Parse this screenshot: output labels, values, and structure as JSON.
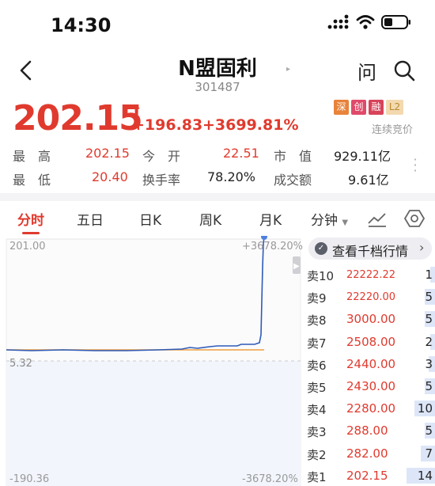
{
  "status_bar": {
    "time": "14:30"
  },
  "header": {
    "stock_name": "N盟固利",
    "stock_code": "301487",
    "ask_label": "问"
  },
  "quote": {
    "price": "202.15",
    "change_abs": "+196.83",
    "change_pct": "+3699.81%",
    "badges": [
      "深",
      "创",
      "融",
      "L2"
    ],
    "status_text": "连续竞价"
  },
  "stats": {
    "high_label": "最　高",
    "high_value": "202.15",
    "open_label": "今　开",
    "open_value": "22.51",
    "mktcap_label": "市　值",
    "mktcap_value": "929.11亿",
    "low_label": "最　低",
    "low_value": "20.40",
    "turnover_label": "换手率",
    "turnover_value": "78.20%",
    "volume_label": "成交额",
    "volume_value": "9.61亿"
  },
  "tabs": [
    "分时",
    "五日",
    "日K",
    "周K",
    "月K",
    "分钟"
  ],
  "chart": {
    "y_top_label": "201.00",
    "y_mid_label": "5.32",
    "y_bottom_label": "-190.36",
    "pct_top_label": "+3678.20%",
    "pct_bottom_label": "-3678.20%"
  },
  "order_book": {
    "header": "查看千档行情",
    "rows": [
      {
        "label": "卖10",
        "price": "22222.22",
        "volume": "1"
      },
      {
        "label": "卖9",
        "price": "22220.00",
        "volume": "5"
      },
      {
        "label": "卖8",
        "price": "3000.00",
        "volume": "5"
      },
      {
        "label": "卖7",
        "price": "2508.00",
        "volume": "2"
      },
      {
        "label": "卖6",
        "price": "2440.00",
        "volume": "3"
      },
      {
        "label": "卖5",
        "price": "2430.00",
        "volume": "5"
      },
      {
        "label": "卖4",
        "price": "2280.00",
        "volume": "10"
      },
      {
        "label": "卖3",
        "price": "288.00",
        "volume": "5"
      },
      {
        "label": "卖2",
        "price": "282.00",
        "volume": "7"
      },
      {
        "label": "卖1",
        "price": "202.15",
        "volume": "14"
      }
    ]
  },
  "colors": {
    "up": "#e03a2e",
    "price_line": "#2e5bb8",
    "avg_line": "#f0a040",
    "volume_bar": "#dde6f8"
  }
}
